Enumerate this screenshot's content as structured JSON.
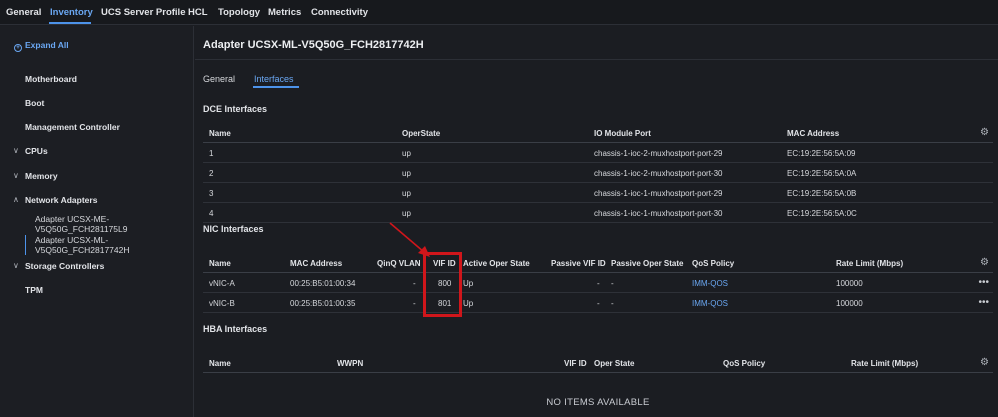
{
  "topnav": {
    "tabs": [
      {
        "label": "General"
      },
      {
        "label": "Inventory"
      },
      {
        "label": "UCS Server Profile"
      },
      {
        "label": "HCL"
      },
      {
        "label": "Topology"
      },
      {
        "label": "Metrics"
      },
      {
        "label": "Connectivity"
      }
    ],
    "active_index": 1
  },
  "sidebar": {
    "expand_all": "Expand All",
    "items": [
      {
        "label": "Motherboard"
      },
      {
        "label": "Boot"
      },
      {
        "label": "Management Controller"
      },
      {
        "label": "CPUs",
        "chevron": "∨"
      },
      {
        "label": "Memory",
        "chevron": "∨"
      },
      {
        "label": "Network Adapters",
        "chevron": "∧"
      },
      {
        "label": "Storage Controllers",
        "chevron": "∨"
      },
      {
        "label": "TPM"
      }
    ],
    "adapters": [
      {
        "line1": "Adapter UCSX-ME-",
        "line2": "V5Q50G_FCH281175L9"
      },
      {
        "line1": "Adapter UCSX-ML-",
        "line2": "V5Q50G_FCH2817742H"
      }
    ]
  },
  "main": {
    "title": "Adapter UCSX-ML-V5Q50G_FCH2817742H",
    "tabs": [
      {
        "label": "General"
      },
      {
        "label": "Interfaces"
      }
    ],
    "active_tab": 1,
    "dce": {
      "title": "DCE Interfaces",
      "columns": [
        "Name",
        "OperState",
        "IO Module Port",
        "MAC Address"
      ],
      "rows": [
        [
          "1",
          "up",
          "chassis-1-ioc-2-muxhostport-port-29",
          "EC:19:2E:56:5A:09"
        ],
        [
          "2",
          "up",
          "chassis-1-ioc-2-muxhostport-port-30",
          "EC:19:2E:56:5A:0A"
        ],
        [
          "3",
          "up",
          "chassis-1-ioc-1-muxhostport-port-29",
          "EC:19:2E:56:5A:0B"
        ],
        [
          "4",
          "up",
          "chassis-1-ioc-1-muxhostport-port-30",
          "EC:19:2E:56:5A:0C"
        ]
      ]
    },
    "nic": {
      "title": "NIC Interfaces",
      "columns": [
        "Name",
        "MAC Address",
        "QinQ VLAN",
        "VIF ID",
        "Active Oper State",
        "Passive VIF ID",
        "Passive Oper State",
        "QoS Policy",
        "Rate Limit (Mbps)"
      ],
      "rows": [
        [
          "vNIC-A",
          "00:25:B5:01:00:34",
          "-",
          "800",
          "Up",
          "-",
          "-",
          "IMM-QOS",
          "100000"
        ],
        [
          "vNIC-B",
          "00:25:B5:01:00:35",
          "-",
          "801",
          "Up",
          "-",
          "-",
          "IMM-QOS",
          "100000"
        ]
      ]
    },
    "hba": {
      "title": "HBA Interfaces",
      "columns": [
        "Name",
        "WWPN",
        "VIF ID",
        "Oper State",
        "QoS Policy",
        "Rate Limit (Mbps)"
      ],
      "empty": "NO ITEMS AVAILABLE"
    }
  },
  "icons": {
    "gear": "gear-icon",
    "more": "more-options-icon",
    "expand": "expand-all-icon"
  },
  "colors": {
    "accent": "#4d93ea",
    "link": "#6aa7f2",
    "highlight": "#d0161b",
    "background": "#1b1d22"
  }
}
